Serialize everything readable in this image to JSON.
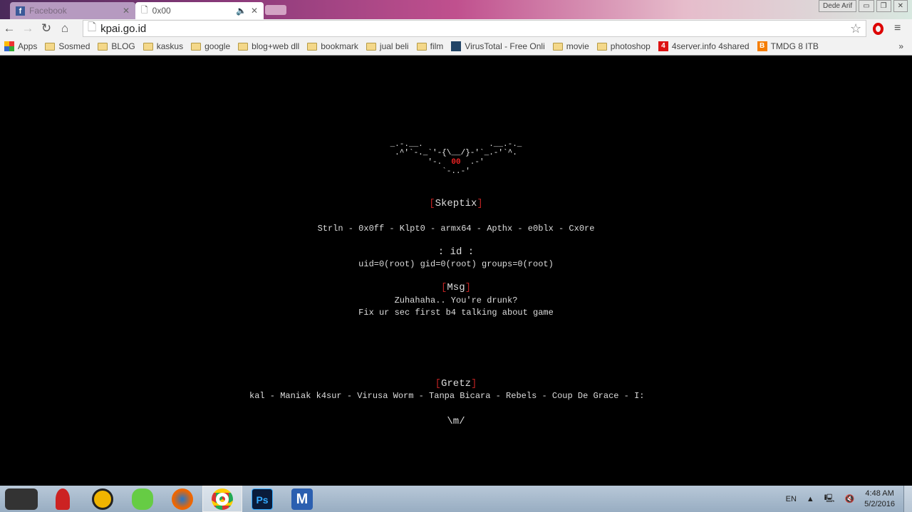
{
  "browser": {
    "tabs": [
      {
        "label": "Facebook",
        "icon": "facebook-icon"
      },
      {
        "label": "0x00",
        "icon": "page-icon",
        "active": true
      }
    ],
    "profile": "Dede Arif",
    "url": "kpai.go.id",
    "bookmarks": [
      {
        "label": "Apps",
        "icon": "apps-grid-icon"
      },
      {
        "label": "Sosmed",
        "icon": "folder-icon"
      },
      {
        "label": "BLOG",
        "icon": "folder-icon"
      },
      {
        "label": "kaskus",
        "icon": "folder-icon"
      },
      {
        "label": "google",
        "icon": "folder-icon"
      },
      {
        "label": "blog+web dll",
        "icon": "folder-icon"
      },
      {
        "label": "bookmark",
        "icon": "folder-icon"
      },
      {
        "label": "jual beli",
        "icon": "folder-icon"
      },
      {
        "label": "film",
        "icon": "folder-icon"
      },
      {
        "label": "VirusTotal - Free Onli",
        "icon": "virustotal-icon"
      },
      {
        "label": "movie",
        "icon": "folder-icon"
      },
      {
        "label": "photoshop",
        "icon": "folder-icon"
      },
      {
        "label": "4server.info 4shared",
        "icon": "4server-icon"
      },
      {
        "label": "TMDG 8 ITB",
        "icon": "blogger-icon"
      }
    ]
  },
  "page": {
    "ascii": [
      "  _.-.__.              .__.-._  ",
      ".^'`-._`'-{\\__/}-'`_.-'`^.",
      "'-.  ",
      "00",
      "  .-'",
      "`-..-'"
    ],
    "team_open": "[",
    "team": "Skeptix",
    "team_close": "]",
    "members": "Strln - 0x0ff - Klpt0 - armx64 - Apthx - e0blx - Cx0re",
    "id_title": ": id :",
    "id_value": "uid=0(root) gid=0(root) groups=0(root)",
    "msg_title": "Msg",
    "msg_lines": [
      "Zuhahaha.. You're drunk?",
      "Fix ur sec first b4 talking about game"
    ],
    "gretz_title": "Gretz",
    "gretz": "kal - Maniak k4sur - Virusa Worm - Tanpa Bicara - Rebels - Coup De Grace - I:",
    "sign": "\\m/"
  },
  "taskbar": {
    "apps": [
      "rog-icon",
      "user-icon",
      "avast-icon",
      "clover-icon",
      "firefox-icon",
      "chrome-icon",
      "photoshop-icon",
      "maxthon-icon"
    ],
    "lang": "EN",
    "time": "4:48 AM",
    "date": "5/2/2016"
  },
  "colors": {
    "accent_red": "#b22222",
    "text": "#dddddd",
    "bg": "#000000"
  }
}
